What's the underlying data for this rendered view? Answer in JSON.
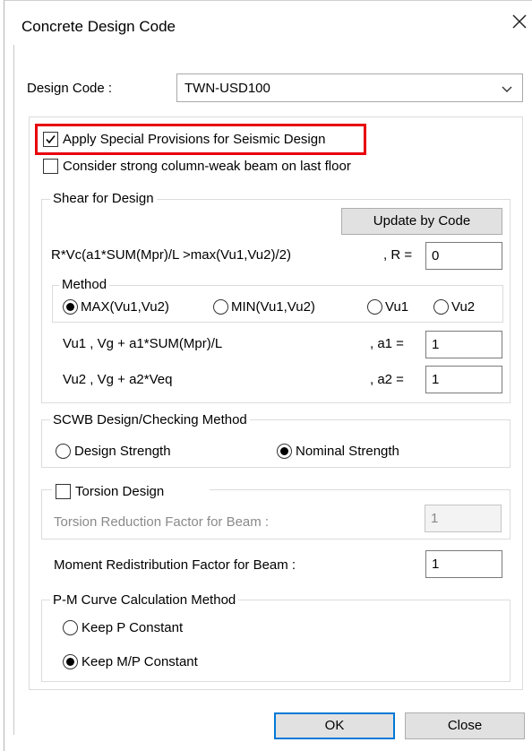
{
  "window": {
    "title": "Concrete Design Code",
    "close_glyph": "✕"
  },
  "design_code": {
    "label": "Design Code :",
    "value": "TWN-USD100"
  },
  "seismic": {
    "apply_label": "Apply Special Provisions for Seismic Design",
    "apply_checked": true,
    "strong_column_label": "Consider strong column-weak beam on last floor",
    "strong_column_checked": false
  },
  "shear": {
    "legend": "Shear for Design",
    "update_button": "Update by Code",
    "formula": "R*Vc(a1*SUM(Mpr)/L >max(Vu1,Vu2)/2)",
    "r_label": ", R =",
    "r_value": "0",
    "method": {
      "legend": "Method",
      "options": [
        "MAX(Vu1,Vu2)",
        "MIN(Vu1,Vu2)",
        "Vu1",
        "Vu2"
      ],
      "selected": "MAX(Vu1,Vu2)"
    },
    "vu1_formula": "Vu1 , Vg + a1*SUM(Mpr)/L",
    "a1_label": ", a1 =",
    "a1_value": "1",
    "vu2_formula": "Vu2 , Vg + a2*Veq",
    "a2_label": ", a2 =",
    "a2_value": "1"
  },
  "scwb": {
    "legend": "SCWB Design/Checking Method",
    "options": [
      "Design Strength",
      "Nominal Strength"
    ],
    "selected": "Nominal Strength"
  },
  "torsion": {
    "legend": "Torsion Design",
    "checked": false,
    "reduction_label": "Torsion Reduction Factor for Beam :",
    "reduction_value": "1"
  },
  "moment": {
    "label": "Moment Redistribution Factor for Beam :",
    "value": "1"
  },
  "pm": {
    "legend": "P-M Curve Calculation Method",
    "options": [
      "Keep P Constant",
      "Keep M/P Constant"
    ],
    "selected": "Keep M/P Constant"
  },
  "buttons": {
    "ok": "OK",
    "close": "Close"
  },
  "colors": {
    "highlight": "#e8000b",
    "focus_border": "#0078d7",
    "button_face": "#e1e1e1"
  }
}
